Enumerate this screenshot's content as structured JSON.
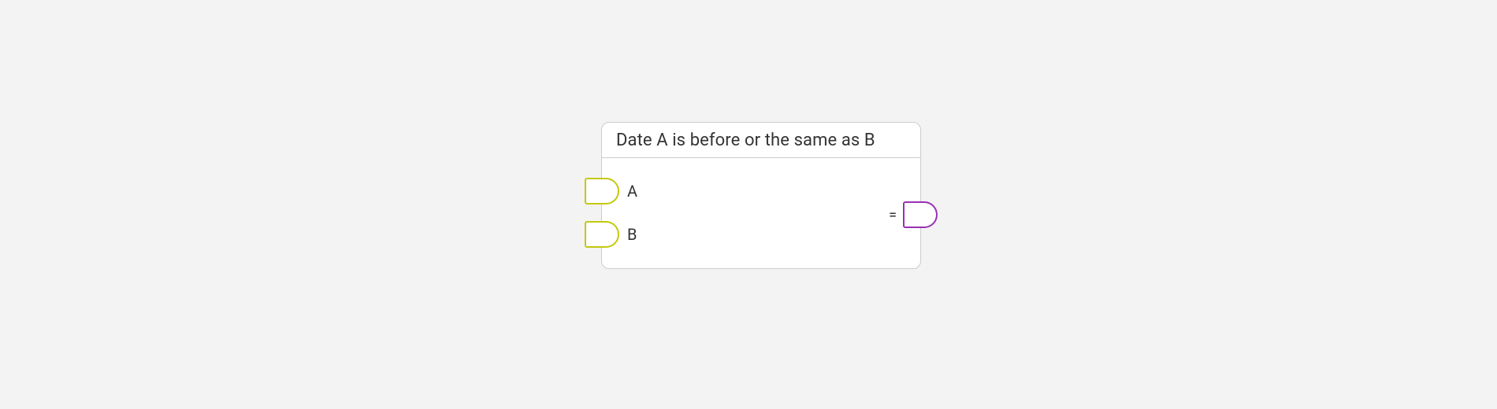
{
  "node": {
    "title": "Date A is before or the same as B",
    "inputs": {
      "a": {
        "label": "A"
      },
      "b": {
        "label": "B"
      }
    },
    "output": {
      "label": "="
    }
  }
}
